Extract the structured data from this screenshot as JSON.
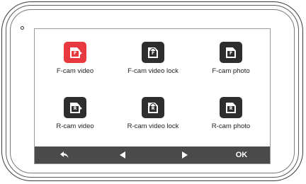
{
  "menu": {
    "items": [
      {
        "label": "F-cam video",
        "badge": "F",
        "type": "video",
        "selected": true
      },
      {
        "label": "F-cam video lock",
        "badge": "F",
        "type": "lock",
        "selected": false
      },
      {
        "label": "F-cam photo",
        "badge": "F",
        "type": "photo",
        "selected": false
      },
      {
        "label": "R-cam video",
        "badge": "R",
        "type": "video",
        "selected": false
      },
      {
        "label": "R-cam video lock",
        "badge": "R",
        "type": "lock",
        "selected": false
      },
      {
        "label": "R-cam photo",
        "badge": "R",
        "type": "photo",
        "selected": false
      }
    ]
  },
  "toolbar": {
    "back_icon": "back-arrow-icon",
    "left_icon": "left-triangle-icon",
    "right_icon": "right-triangle-icon",
    "ok_label": "OK"
  },
  "colors": {
    "selected_tile": "#e8393f",
    "tile": "#2e2e2e",
    "toolbar": "#4a4a4a"
  }
}
